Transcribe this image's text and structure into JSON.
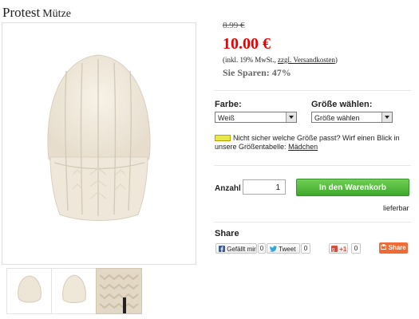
{
  "product": {
    "brand": "Protest",
    "name": "Mütze",
    "old_price": "8.99 €",
    "price": "10.00 €",
    "tax_prefix": "(inkl. 19% MwSt.,",
    "shipping_link": "zzgl. Versandkosten",
    "tax_suffix": ")",
    "savings": "Sie Sparen: 47%"
  },
  "options": {
    "color_label": "Farbe:",
    "color_value": "Weiß",
    "size_label": "Größe wählen:",
    "size_value": "Größe wählen"
  },
  "size_hint": {
    "text": "Nicht sicher welche Größe passt? Wirf einen Blick in unsere Größentabelle:",
    "link": "Mädchen"
  },
  "purchase": {
    "qty_label": "Anzahl",
    "qty_value": "1",
    "cart_label": "In den Warenkorb",
    "stock": "lieferbar"
  },
  "share": {
    "title": "Share",
    "fb_label": "Gefällt mir",
    "fb_count": "0",
    "tweet_label": "Tweet",
    "tweet_count": "0",
    "gplus_label": "+1",
    "gplus_count": "0",
    "share_label": "Share"
  },
  "colors": {
    "price_red": "#e00000",
    "cart_green": "#4cbc37",
    "share_orange": "#f06a35"
  },
  "icons": [
    "ruler-icon",
    "facebook-icon",
    "twitter-icon",
    "google-plus-icon",
    "share-icon",
    "select-arrow-icon"
  ]
}
